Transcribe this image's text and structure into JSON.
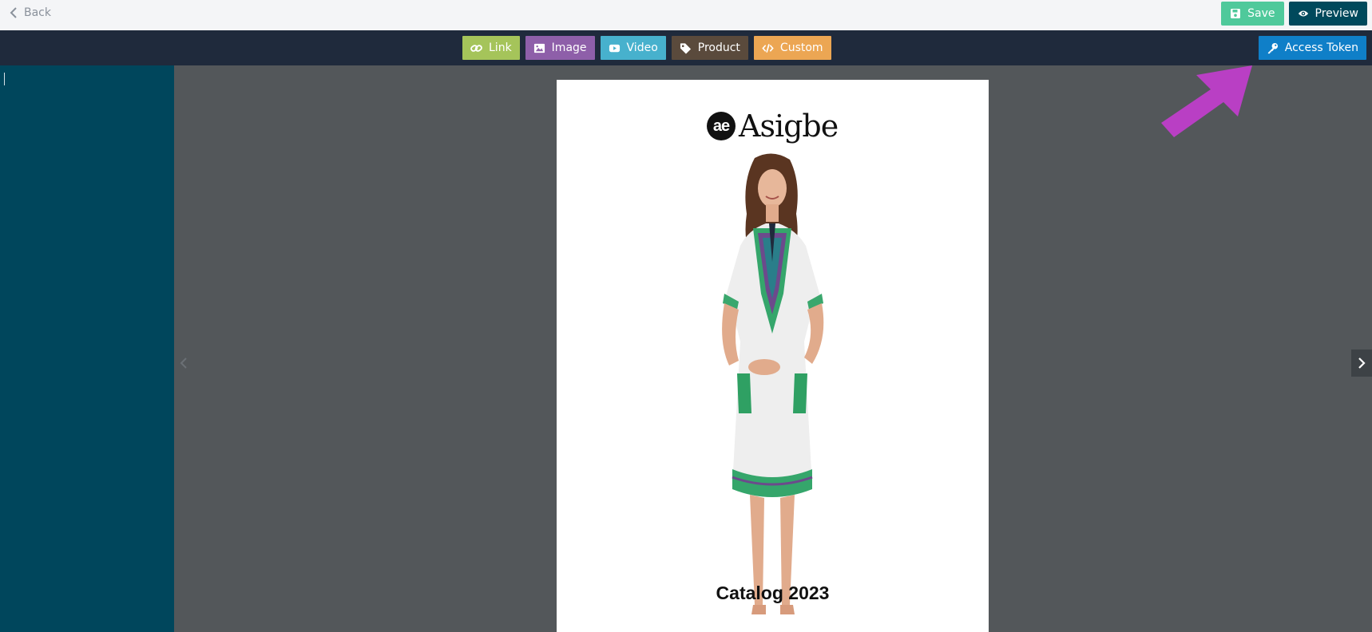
{
  "topbar": {
    "back_label": "Back",
    "save_label": "Save",
    "preview_label": "Preview"
  },
  "toolbar": {
    "tools": [
      {
        "label": "Link",
        "icon": "link-icon",
        "color": "#a5c45a"
      },
      {
        "label": "Image",
        "icon": "image-icon",
        "color": "#8e5fa9"
      },
      {
        "label": "Video",
        "icon": "video-icon",
        "color": "#47b1cd"
      },
      {
        "label": "Product",
        "icon": "tag-icon",
        "color": "#5a4a3c"
      },
      {
        "label": "Custom",
        "icon": "code-icon",
        "color": "#eca653"
      }
    ],
    "access_token_label": "Access Token"
  },
  "page": {
    "logo_badge": "ae",
    "logo_text": "Asigbe",
    "title": "Catalog  2023"
  },
  "colors": {
    "sidebar": "#00465c",
    "toolbar": "#1f2a3c",
    "canvas": "#53575a",
    "annotation_arrow": "#b93fc4"
  }
}
